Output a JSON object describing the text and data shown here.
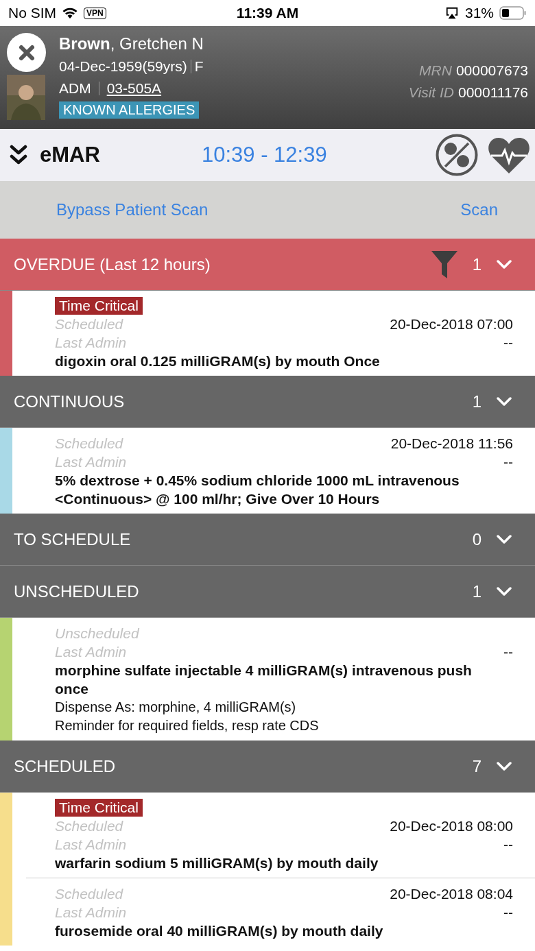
{
  "status_bar": {
    "carrier": "No SIM",
    "vpn": "VPN",
    "time": "11:39 AM",
    "battery": "31%"
  },
  "patient": {
    "last_name": "Brown",
    "first_name": ", Gretchen N",
    "dob": "04-Dec-1959",
    "age": "(59yrs)",
    "sex": "F",
    "status": "ADM",
    "location": "03-505A",
    "allergy_badge": "KNOWN ALLERGIES",
    "mrn_label": "MRN",
    "mrn": "000007673",
    "visit_label": "Visit ID",
    "visit_id": "000011176"
  },
  "toolbar": {
    "title": "eMAR",
    "time_range": "10:39 - 12:39"
  },
  "scan_bar": {
    "bypass": "Bypass Patient Scan",
    "scan": "Scan"
  },
  "sections": [
    {
      "title": "OVERDUE (Last 12 hours)",
      "count": "1",
      "kind": "overdue",
      "color": "#d05c63",
      "items": [
        {
          "badge": "Time Critical",
          "schedule_label": "Scheduled",
          "schedule_value": "20-Dec-2018 07:00",
          "last_admin_label": "Last Admin",
          "last_admin_value": "--",
          "description": "digoxin   oral 0.125 milliGRAM(s)  by mouth  Once"
        }
      ]
    },
    {
      "title": "CONTINUOUS",
      "count": "1",
      "kind": "normal",
      "color": "#a9d9e7",
      "items": [
        {
          "schedule_label": "Scheduled",
          "schedule_value": "20-Dec-2018 11:56",
          "last_admin_label": "Last Admin",
          "last_admin_value": "--",
          "description": "5% dextrose + 0.45% sodium chloride 1000 mL intravenous <Continuous> @ 100 ml/hr; Give Over 10 Hours"
        }
      ]
    },
    {
      "title": "TO SCHEDULE",
      "count": "0",
      "kind": "normal"
    },
    {
      "title": "UNSCHEDULED",
      "count": "1",
      "kind": "normal",
      "color": "#b6d371",
      "items": [
        {
          "schedule_label": "Unscheduled",
          "last_admin_label": "Last Admin",
          "last_admin_value": "--",
          "description": "morphine sulfate injectable 4 milliGRAM(s) intravenous push once",
          "notes": [
            "Dispense As: morphine, 4 milliGRAM(s)",
            "Reminder for required fields, resp rate CDS"
          ]
        }
      ]
    },
    {
      "title": "SCHEDULED",
      "count": "7",
      "kind": "normal",
      "color": "#f6de8c",
      "items": [
        {
          "badge": "Time Critical",
          "schedule_label": "Scheduled",
          "schedule_value": "20-Dec-2018 08:00",
          "last_admin_label": "Last Admin",
          "last_admin_value": "--",
          "description": "warfarin sodium 5 milliGRAM(s) by mouth daily"
        },
        {
          "schedule_label": "Scheduled",
          "schedule_value": "20-Dec-2018 08:04",
          "last_admin_label": "Last Admin",
          "last_admin_value": "--",
          "description": "furosemide oral 40 milliGRAM(s)  by mouth  daily"
        }
      ]
    }
  ]
}
